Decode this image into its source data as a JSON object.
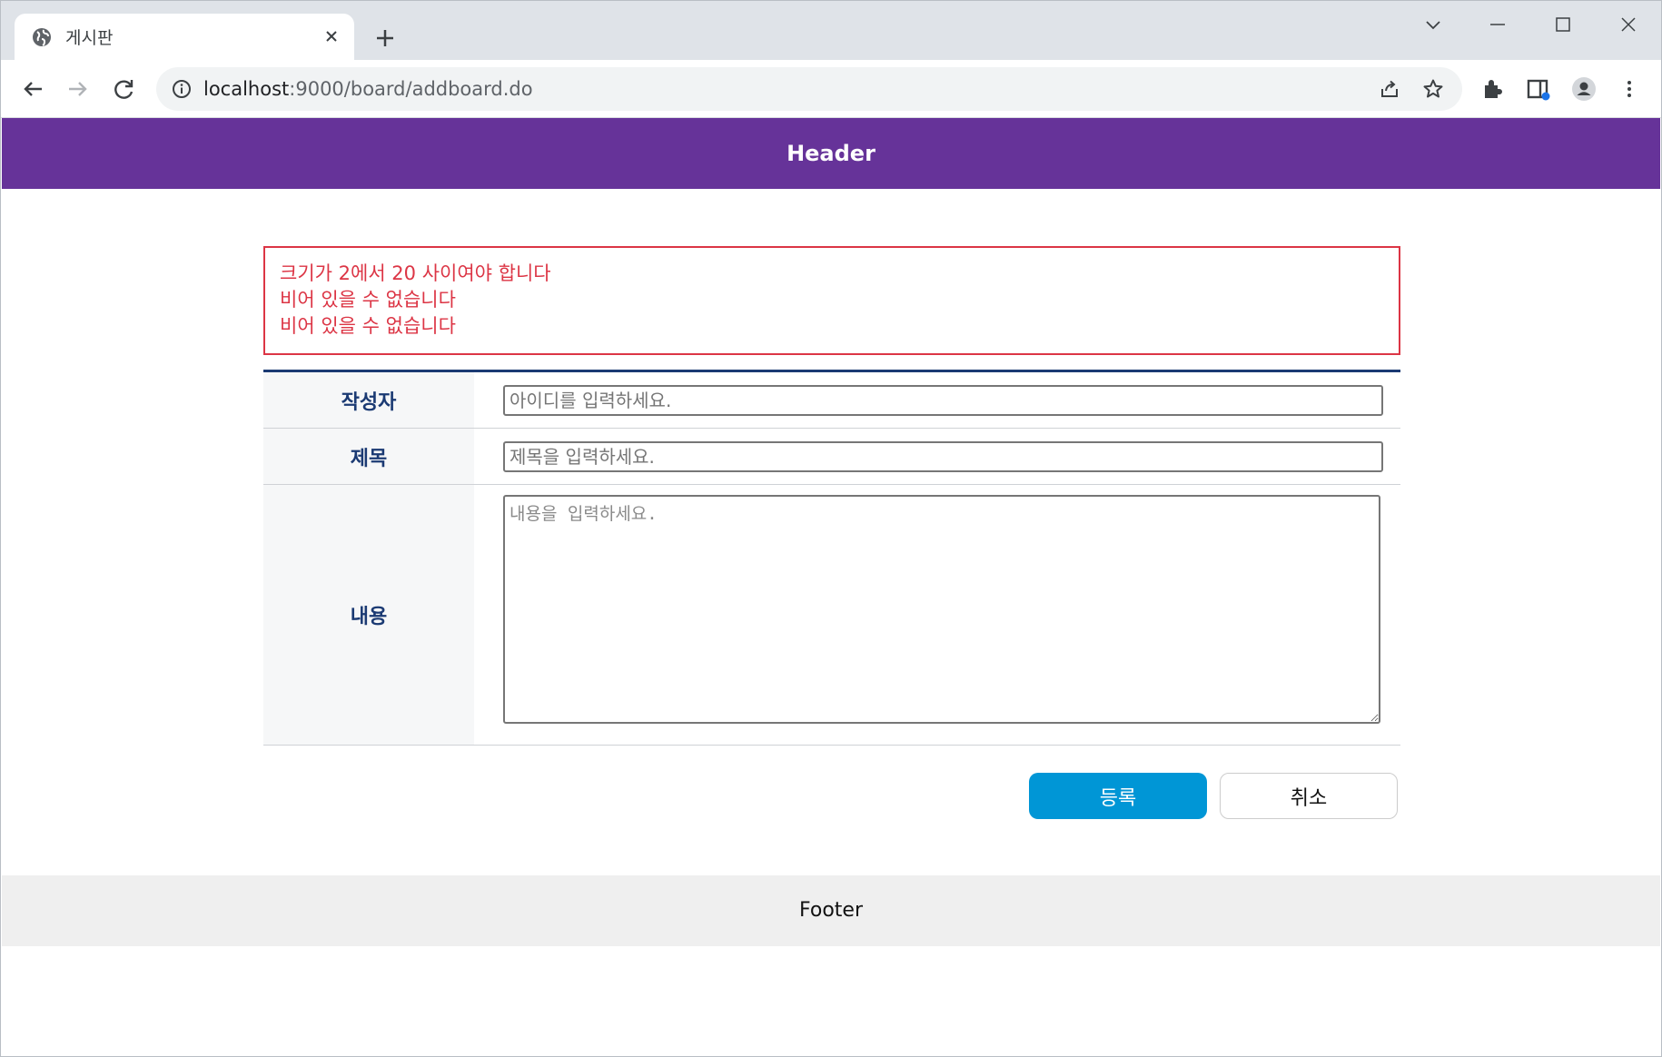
{
  "browser": {
    "tab_title": "게시판",
    "url_host": "localhost",
    "url_rest": ":9000/board/addboard.do"
  },
  "page": {
    "header": "Header",
    "errors": [
      "크기가 2에서 20 사이여야 합니다",
      "비어 있을 수 없습니다",
      "비어 있을 수 없습니다"
    ],
    "form": {
      "writer_label": "작성자",
      "writer_placeholder": "아이디를 입력하세요.",
      "title_label": "제목",
      "title_placeholder": "제목을 입력하세요.",
      "content_label": "내용",
      "content_placeholder": "내용을 입력하세요."
    },
    "buttons": {
      "submit": "등록",
      "cancel": "취소"
    },
    "footer": "Footer"
  },
  "colors": {
    "header_bg": "#663399",
    "error": "#dc3545",
    "label_text": "#1b3a73",
    "submit_bg": "#0096d6"
  }
}
